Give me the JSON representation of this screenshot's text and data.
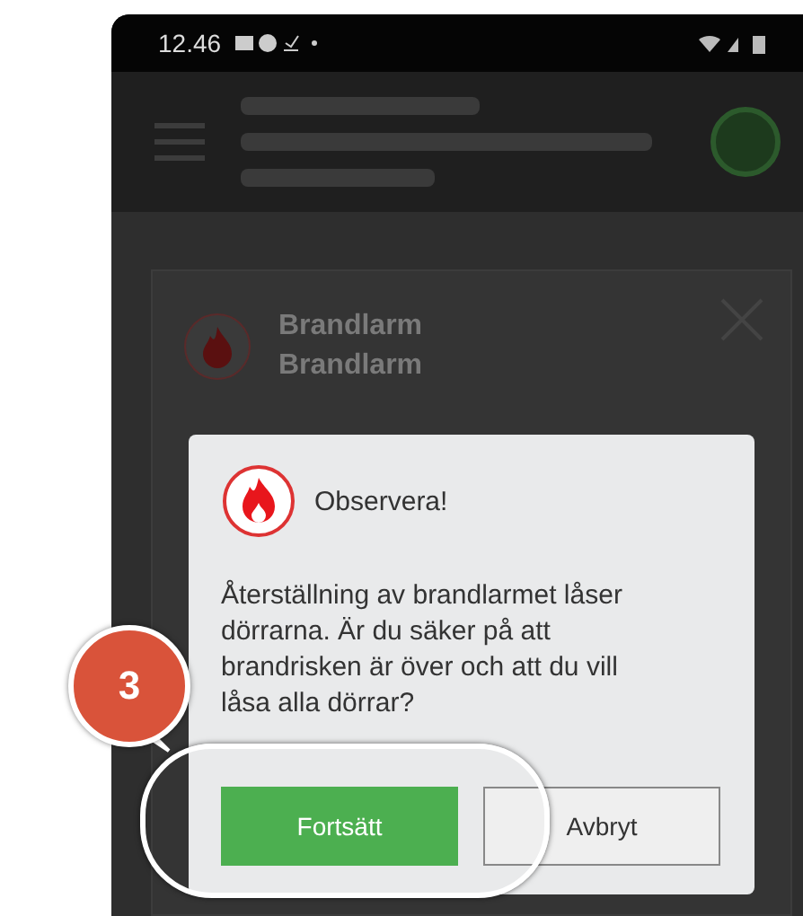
{
  "status_bar": {
    "time": "12.46"
  },
  "background_card": {
    "lines": [
      "Brandlarm",
      "Brandlarm"
    ]
  },
  "dialog": {
    "title": "Observera!",
    "message": "Återställning av brandlarmet låser dörrarna. Är du säker på att brandrisken är över och att du vill låsa alla dörrar?",
    "buttons": [
      {
        "label": "Fortsätt",
        "kind": "primary"
      },
      {
        "label": "Avbryt",
        "kind": "secondary"
      }
    ]
  },
  "callout": {
    "number": "3"
  }
}
